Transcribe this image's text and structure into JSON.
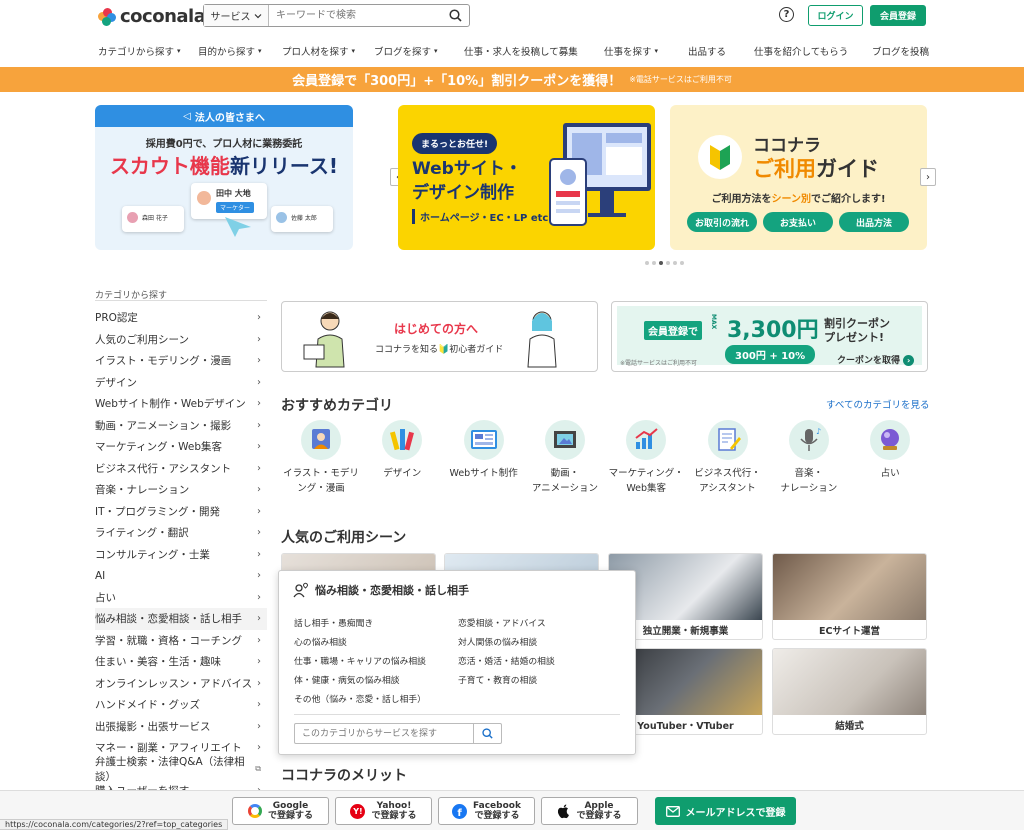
{
  "header": {
    "logo_text": "coconala",
    "search": {
      "category": "サービス",
      "placeholder": "キーワードで検索"
    },
    "help_glyph": "?",
    "login_label": "ログイン",
    "register_label": "会員登録"
  },
  "nav": [
    "カテゴリから探す",
    "目的から探す",
    "プロ人材を探す",
    "ブログを探す",
    "仕事・求人を投稿して募集",
    "仕事を探す",
    "出品する",
    "仕事を紹介してもらう",
    "ブログを投稿"
  ],
  "banner": {
    "text": "会員登録で「300円」+「10%」割引クーポンを獲得！",
    "note": "※電話サービスはご利用不可"
  },
  "carousel": {
    "slide1": {
      "tag": "法人の皆さまへ",
      "sub": "採用費0円で、プロ人材に業務委託",
      "main_red": "スカウト機能",
      "main_navy": "新リリース!",
      "card_name": "田中 大地",
      "card_role": "マーケター",
      "card_left": "森田 花子",
      "card_right": "佐藤 太郎"
    },
    "slide2": {
      "pill": "まるっとお任せ!",
      "line1": "Webサイト・",
      "line2": "デザイン制作",
      "foot": "ホームページ・EC・LP etc."
    },
    "slide3": {
      "line1": "ココナラ",
      "line2a": "ご利用",
      "line2b": "ガイド",
      "line3a": "ご利用方法を",
      "line3b": "シーン別",
      "line3c": "でご紹介します!",
      "buttons": [
        "お取引の流れ",
        "お支払い",
        "出品方法"
      ]
    },
    "prev": "‹",
    "next": "›"
  },
  "sidebar": {
    "title": "カテゴリから探す",
    "items": [
      "PRO認定",
      "人気のご利用シーン",
      "イラスト・モデリング・漫画",
      "デザイン",
      "Webサイト制作・Webデザイン",
      "動画・アニメーション・撮影",
      "マーケティング・Web集客",
      "ビジネス代行・アシスタント",
      "音楽・ナレーション",
      "IT・プログラミング・開発",
      "ライティング・翻訳",
      "コンサルティング・士業",
      "AI",
      "占い",
      "悩み相談・恋愛相談・話し相手",
      "学習・就職・資格・コーチング",
      "住まい・美容・生活・趣味",
      "オンラインレッスン・アドバイス",
      "ハンドメイド・グッズ",
      "出張撮影・出張サービス",
      "マネー・副業・アフィリエイト",
      "弁護士検索・法律Q&A（法律相談）",
      "購入ユーザーを探す"
    ],
    "active_index": 14
  },
  "promo": {
    "beginner_title": "はじめての方へ",
    "beginner_sub": "ココナラを知る🔰初心者ガイド",
    "coupon_badge": "会員登録で",
    "coupon_max": "MAX",
    "coupon_amount": "3,300円",
    "coupon_breakdown": "300円 + 10%",
    "coupon_title1": "割引クーポン",
    "coupon_title2": "プレゼント!",
    "coupon_cta": "クーポンを取得",
    "coupon_note": "※電話サービスはご利用不可"
  },
  "recommended": {
    "title": "おすすめカテゴリ",
    "see_all": "すべてのカテゴリを見る",
    "items": [
      {
        "l1": "イラスト・モデリ",
        "l2": "ング・漫画"
      },
      {
        "l1": "デザイン",
        "l2": ""
      },
      {
        "l1": "Webサイト制作",
        "l2": ""
      },
      {
        "l1": "動画・",
        "l2": "アニメーション"
      },
      {
        "l1": "マーケティング・",
        "l2": "Web集客"
      },
      {
        "l1": "ビジネス代行・",
        "l2": "アシスタント"
      },
      {
        "l1": "音楽・",
        "l2": "ナレーション"
      },
      {
        "l1": "占い",
        "l2": ""
      }
    ]
  },
  "popular": {
    "title": "人気のご利用シーン",
    "tiles": [
      "独立開業・新規事業",
      "ECサイト運営",
      "YouTuber・VTuber",
      "結婚式"
    ]
  },
  "flyout": {
    "title": "悩み相談・恋愛相談・話し相手",
    "left": [
      "話し相手・愚痴聞き",
      "心の悩み相談",
      "仕事・職場・キャリアの悩み相談",
      "体・健康・病気の悩み相談",
      "その他（悩み・恋愛・話し相手）"
    ],
    "right": [
      "恋愛相談・アドバイス",
      "対人関係の悩み相談",
      "恋活・婚活・結婚の相談",
      "子育て・教育の相談"
    ],
    "search_placeholder": "このカテゴリからサービスを探す"
  },
  "merit_title": "ココナラのメリット",
  "signup": {
    "google": [
      "Google",
      "で登録する"
    ],
    "yahoo": [
      "Yahoo!",
      "で登録する"
    ],
    "facebook": [
      "Facebook",
      "で登録する"
    ],
    "apple": [
      "Apple",
      "で登録する"
    ],
    "mail": "メールアドレスで登録"
  },
  "status_url": "https://coconala.com/categories/2?ref=top_categories",
  "colors": {
    "brand_green": "#0f9d6e",
    "banner_orange": "#f7a33c",
    "link_blue": "#1a6fc9",
    "alert_red": "#e8374b"
  }
}
